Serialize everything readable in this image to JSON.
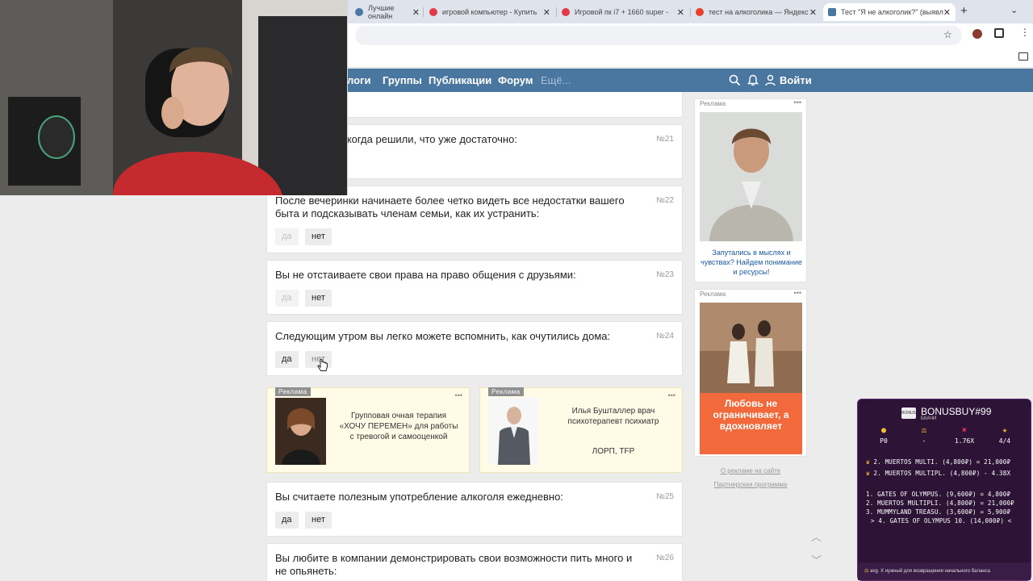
{
  "browser": {
    "tabs": [
      {
        "title": "Лучшие онлайн",
        "favicon_color": "#4a77a0"
      },
      {
        "title": "игровой компьютер - Купить",
        "favicon_color": "#e2394a"
      },
      {
        "title": "Игровой пк i7 + 1660 super -",
        "favicon_color": "#e2394a"
      },
      {
        "title": "тест на алкоголика — Яндекс",
        "favicon_color": "#e8402b"
      },
      {
        "title": "Тест \"Я не алкоголик?\" (выявл",
        "favicon_color": "#4a77a0"
      }
    ],
    "new_tab": "+",
    "close_glyph": "✕"
  },
  "site_nav": {
    "items": [
      "логи",
      "Группы",
      "Публикации",
      "Форум"
    ],
    "more": "Ещё...",
    "login": "Войти"
  },
  "questions": [
    {
      "number": "№21",
      "text": "остановиться, когда решили, что уже достаточно:",
      "yes": "",
      "no": ""
    },
    {
      "number": "№22",
      "text": "После вечеринки начинаете более четко видеть все недостатки вашего быта и подсказывать членам семьи, как их устранить:",
      "yes": "да",
      "no": "нет",
      "selected": "нет"
    },
    {
      "number": "№23",
      "text": "Вы не отстаиваете свои права на право общения с друзьями:",
      "yes": "да",
      "no": "нет",
      "selected": "нет"
    },
    {
      "number": "№24",
      "text": "Следующим утром вы легко можете вспомнить, как очутились дома:",
      "yes": "да",
      "no": "нет",
      "selected": ""
    },
    {
      "number": "№25",
      "text": "Вы считаете полезным употребление алкоголя ежедневно:",
      "yes": "да",
      "no": "нет",
      "selected": ""
    },
    {
      "number": "№26",
      "text": "Вы любите в компании демонстрировать свои возможности пить много и не опьянеть:",
      "yes": "",
      "no": ""
    }
  ],
  "inline_ads": [
    {
      "label": "Реклама",
      "text": "Групповая очная терапия «ХОЧУ ПЕРЕМЕН» для работы с тревогой и самооценкой"
    },
    {
      "label": "Реклама",
      "text": "Илья Бушталлер врач психотерапевт психиатр",
      "text2": "ЛОРП, ТFP"
    }
  ],
  "rail": {
    "ad1": {
      "label": "Реклама",
      "caption": "Запутались в мыслях и чувствах? Найдем понимание и ресурсы!"
    },
    "ad2": {
      "label": "Реклама",
      "banner_text": "Любовь не ограничивает, а вдохновляет"
    },
    "link1": "О рекламе на сайте",
    "link2": "Партнерская программа"
  },
  "widget": {
    "title": "BONUSBUY#99",
    "subtitle": "БКАЧИ",
    "logo_text": "BONUS",
    "stats": [
      "Р0",
      "-",
      "1.76X",
      "4/4"
    ],
    "top_lines": [
      "2. MUERTOS MULTI. (4,800₽) = 21,000₽",
      "2. MUERTOS MULTIPL. (4,800₽) - 4.38X"
    ],
    "list": [
      "1. GATES OF OLYMPUS. (9,600₽) = 4,800₽",
      "2. MUERTOS MULTIPLI. (4,800₽) = 21,000₽",
      "3. MUMMYLAND TREASU. (3,600₽) = 5,900₽",
      "> 4. GATES OF OLYMPUS 10. (14,000₽) <"
    ],
    "footer": "avg. X нужный для возвращения начального баланса"
  }
}
